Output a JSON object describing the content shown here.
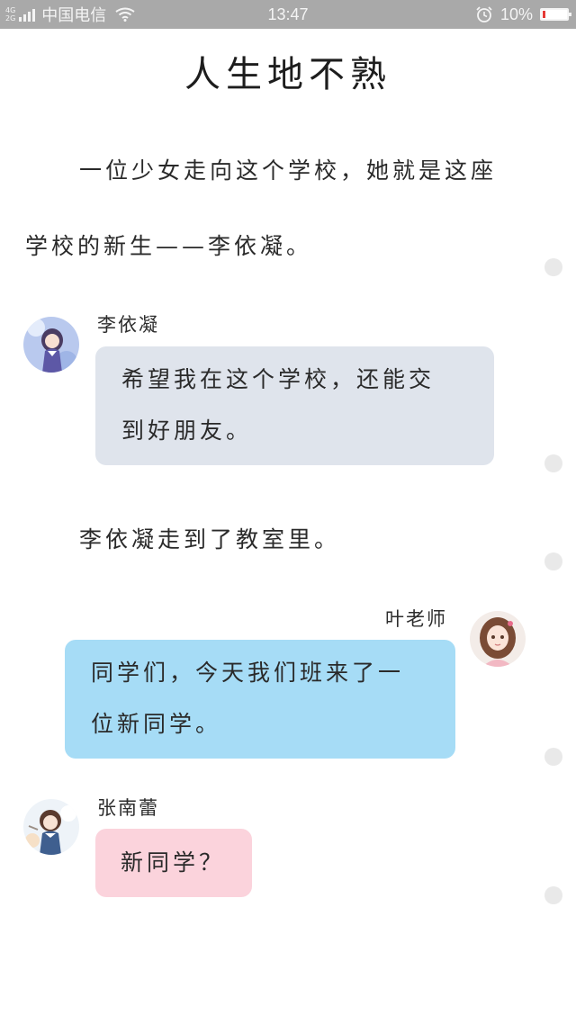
{
  "status_bar": {
    "network_top": "4G",
    "network_bottom": "2G",
    "carrier": "中国电信",
    "time": "13:47",
    "battery": "10%",
    "battery_level": 0.1,
    "battery_color": "#e53935"
  },
  "story": {
    "title": "人生地不熟",
    "narration": [
      "一位少女走向这个学校，她就是这座",
      "学校的新生——李依凝。",
      "李依凝走到了教室里。"
    ],
    "messages": [
      {
        "speaker": "李依凝",
        "lines": [
          "希望我在这个学校，还能交",
          "到好朋友。"
        ],
        "bubble_color": "#dfe4ec",
        "avatar": "girl-avatar"
      },
      {
        "speaker": "叶老师",
        "lines": [
          "同学们，今天我们班来了一",
          "位新同学。"
        ],
        "bubble_color": "#a6dcf6",
        "avatar": "teacher-avatar"
      },
      {
        "speaker": "张南蕾",
        "lines": [
          "新同学？"
        ],
        "bubble_color": "#fbd3dc",
        "avatar": "girl-avatar"
      }
    ]
  },
  "icons": {
    "signal": "signal-icon",
    "wifi": "wifi-icon",
    "alarm": "alarm-clock-icon",
    "battery": "battery-icon",
    "scroll_marker": "scroll-dot"
  }
}
